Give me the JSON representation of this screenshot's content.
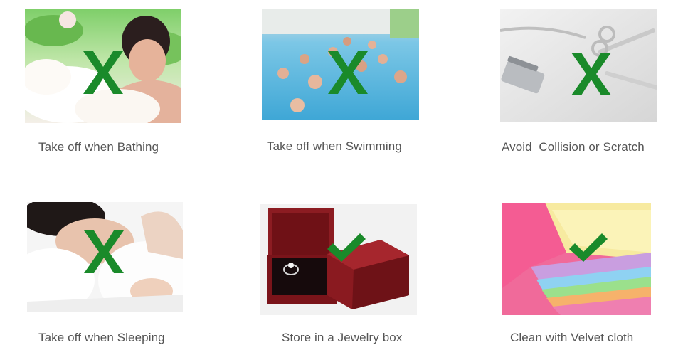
{
  "colors": {
    "mark_green": "#1a8a2a",
    "caption_text": "#555555"
  },
  "items": [
    {
      "caption": "Take off when Bathing",
      "scene": "bathing-photo",
      "mark": "cross-icon"
    },
    {
      "caption": "Take off when Swimming",
      "scene": "swimming-pool-photo",
      "mark": "cross-icon"
    },
    {
      "caption": "Avoid  Collision or Scratch",
      "scene": "tools-photo",
      "mark": "cross-icon"
    },
    {
      "caption": "Take off when Sleeping",
      "scene": "sleeping-photo",
      "mark": "cross-icon"
    },
    {
      "caption": "Store in a Jewelry box",
      "scene": "jewelry-box-photo",
      "mark": "check-icon"
    },
    {
      "caption": "Clean with Velvet cloth",
      "scene": "velvet-cloth-photo",
      "mark": "check-icon"
    }
  ]
}
